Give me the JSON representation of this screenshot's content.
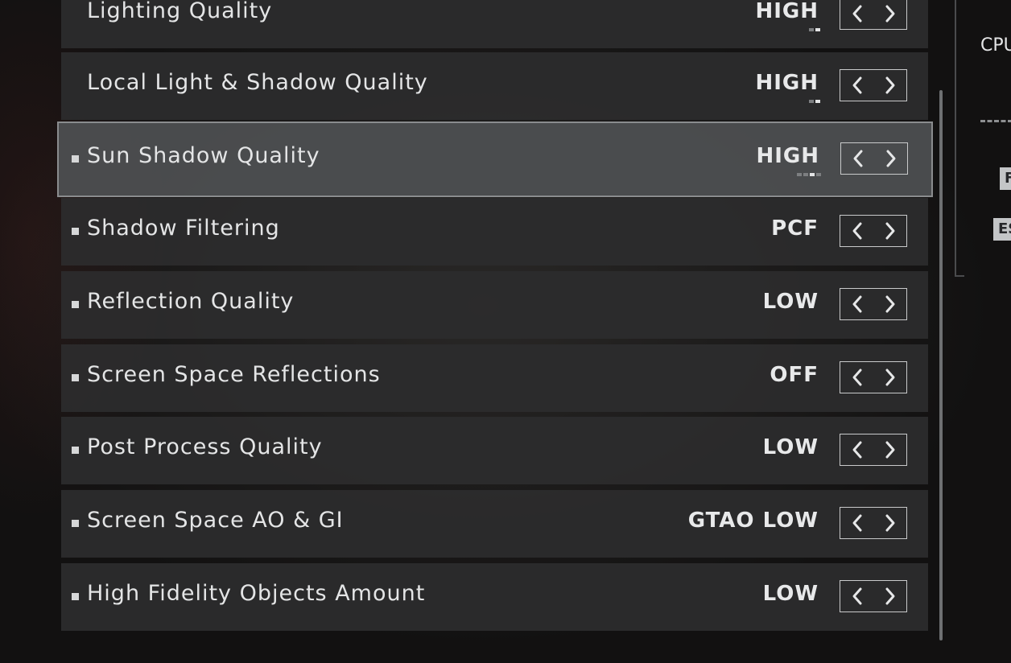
{
  "settings": [
    {
      "label": "Lighting Quality",
      "value": "HIGH",
      "bullet": false,
      "pips": [
        false,
        true
      ]
    },
    {
      "label": "Local Light & Shadow Quality",
      "value": "HIGH",
      "bullet": false,
      "pips": [
        false,
        true
      ]
    },
    {
      "label": "Sun Shadow Quality",
      "value": "HIGH",
      "bullet": true,
      "selected": true,
      "pips": [
        false,
        false,
        true,
        false
      ]
    },
    {
      "label": "Shadow Filtering",
      "value": "PCF",
      "bullet": true
    },
    {
      "label": "Reflection Quality",
      "value": "LOW",
      "bullet": true
    },
    {
      "label": "Screen Space Reflections",
      "value": "OFF",
      "bullet": true
    },
    {
      "label": "Post Process Quality",
      "value": "LOW",
      "bullet": true
    },
    {
      "label": "Screen Space AO & GI",
      "value": "GTAO LOW",
      "bullet": true
    },
    {
      "label": "High Fidelity Objects Amount",
      "value": "LOW",
      "bullet": true
    }
  ],
  "side_panel": {
    "title": "CPU",
    "key1": "F",
    "key2": "ES"
  },
  "icons": {
    "prev": "chevron-left-icon",
    "next": "chevron-right-icon"
  }
}
